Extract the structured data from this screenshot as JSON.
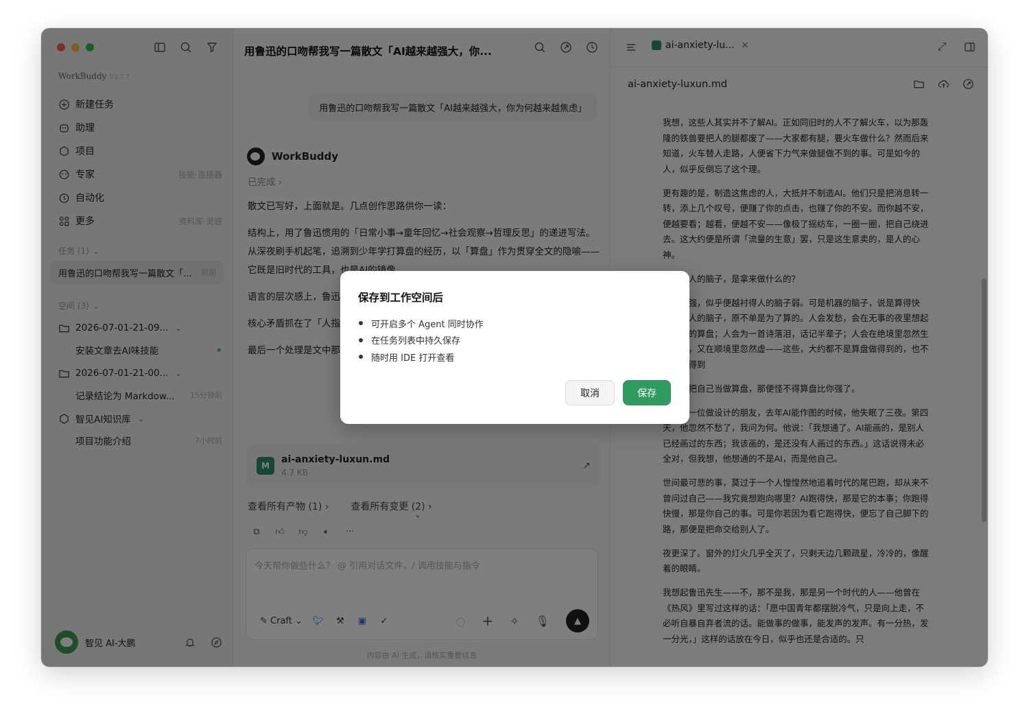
{
  "brand": {
    "name": "WorkBuddy",
    "badge": "V3.7.7"
  },
  "sidebar": {
    "nav": [
      {
        "label": "新建任务",
        "icon": "plus-circle-icon",
        "hint": ""
      },
      {
        "label": "助理",
        "icon": "assistant-icon",
        "hint": ""
      },
      {
        "label": "项目",
        "icon": "project-icon",
        "hint": ""
      },
      {
        "label": "专家",
        "icon": "expert-icon",
        "hint": "技能·连接器"
      },
      {
        "label": "自动化",
        "icon": "clock-icon",
        "hint": ""
      },
      {
        "label": "更多",
        "icon": "grid-icon",
        "hint": "资料库·灵感"
      }
    ],
    "tasks_title": "任务 (1)",
    "active_task": {
      "label": "用鲁迅的口吻帮我写一篇散文「...",
      "hint": "刚刚"
    },
    "spaces_title": "空间 (3)",
    "spaces": [
      {
        "label": "2026-07-01-21-09...",
        "type": "folder"
      },
      {
        "label": "安装文章去AI味技能",
        "type": "task"
      },
      {
        "label": "2026-07-01-21-00...",
        "type": "folder"
      },
      {
        "label": "记录结论为 Markdow...",
        "type": "task",
        "hint": "15分钟前"
      },
      {
        "label": "智见AI知识库",
        "type": "kb"
      },
      {
        "label": "项目功能介绍",
        "type": "task",
        "hint": "7小时前"
      }
    ],
    "user": {
      "name": "智见 AI-大鹏"
    }
  },
  "chat": {
    "title": "用鲁迅的口吻帮我写一篇散文「AI越来越强大，你...",
    "user_message": "用鲁迅的口吻帮我写一篇散文「AI越来越强大，你为何越来越焦虑」",
    "bot_name": "WorkBuddy",
    "status": "已完成",
    "paragraphs": [
      "散文已写好，上面就是。几点创作思路供你一读：",
      "结构上，用了鲁迅惯用的「日常小事→童年回忆→社会观察→哲理反思」的递进写法。从深夜刷手机起笔，追溯到少年学打算盘的经历，以「算盘」作为贯穿全文的隐喻——它既是旧时代的工具，也是AI的镜像。",
      "语言的层次感上，鲁迅入沉思时转入略带文言，节奏变化让文章有了呼吸。",
      "核心矛盾抓在了「人指的思维模式。你在焦虑",
      "最后一个处理是文中那对模仿本身的自觉调侃，也划清了「笔意」与「本人」的界限。"
    ],
    "file": {
      "name": "ai-anxiety-luxun.md",
      "size": "4.7 KB",
      "icon_label": "M"
    },
    "links": [
      "查看所有产物 (1)",
      "查看所有变更 (2)"
    ],
    "composer": {
      "placeholder": "今天帮你做些什么？ @ 引用对话文件，/ 调用技能与指令",
      "mode": "Craft"
    },
    "disclaimer": "内容由 AI 生成，请核实重要信息"
  },
  "doc": {
    "tab": "ai-anxiety-lu...",
    "path": "ai-anxiety-luxun.md",
    "paragraphs": [
      "我想，这些人其实并不了解AI。正如同旧时的人不了解火车，以为那轰隆的铁兽要把人的腿都废了——大家都有腿，要火车做什么？然而后来知道，火车替人走路，人便省下力气来做腿做不到的事。可是如今的人，似乎反倒忘了这个理。",
      "更有趣的是，制造这焦虑的人，大抵并不制造AI。他们只是把消息转一转，添上几个叹号，便赚了你的点击，也赚了你的不安。而你越不安，便越要看；越看，便越不安——像极了摇纺车，一圈一圈，把自己绕进去。这大约便是所谓「流量的生意」罢，只是这生意卖的，是人的心神。",
      "我想：人的脑子，是拿来做什么的？",
      "脑子越强，似乎便越衬得人的脑子弱。可是机器的脑子，说是算得快些；而人的脑子，原不单是为了算的。人会发愁，会在无事的夜里想起少年时的算盘；人会为一首诗落泪，话记半辈子；人会在绝境里忽然生出希望，又在顺境里忽然虚——这些，大约都不是算盘做得到的，也不是AI做得到",
      "自己先把自己当做算盘，那便怪不得算盘比你强了。",
      "我认识一位做设计的朋友，去年AI能作图的时候，他失眠了三夜。第四天，他忽然不愁了，我问为何。他说：「我想通了。AI能画的，是别人已经画过的东西；我该画的，是还没有人画过的东西。」这话说得未必全对，但我想，他想通的不是AI，而是他自己。",
      "世间最可悲的事，莫过于一个人惶惶然地追着时代的尾巴跑，却从来不曾问过自己——我究竟想跑向哪里？AI跑得快，那是它的本事；你跑得快慢，那是你自己的事。可是你若因为看它跑得快，便忘了自己脚下的路，那便是把命交给别人了。",
      "夜更深了。窗外的灯火几乎全灭了，只剩天边几颗疏星，冷冷的，像醒着的眼睛。",
      "我想起鲁迅先生——不，那不是我，那是另一个时代的人——他曾在《热风》里写过这样的话：「愿中国青年都摆脱冷气，只是向上走，不必听自暴自弃者流的话。能做事的做事，能发声的发声。有一分热，发一分光，」这样的话放在今日，似乎也还是合适的。只"
    ]
  },
  "modal": {
    "title": "保存到工作空间后",
    "items": [
      "可开启多个 Agent 同时协作",
      "在任务列表中持久保存",
      "随时用 IDE 打开查看"
    ],
    "cancel": "取消",
    "save": "保存"
  },
  "colors": {
    "accent": "#2f9b5e",
    "overlay": "rgba(0,0,0,0.5)"
  }
}
